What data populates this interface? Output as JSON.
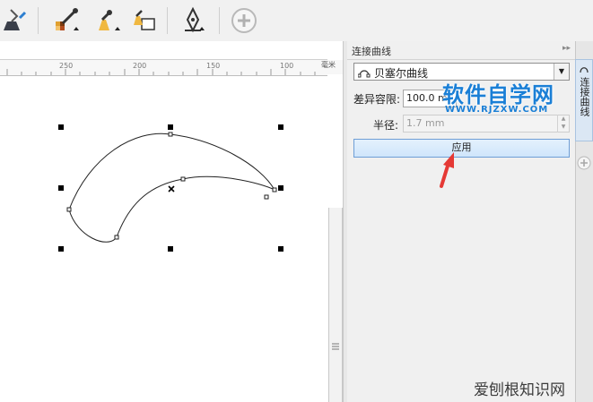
{
  "toolbar": {
    "tools": [
      {
        "icon": "fill-bucket-icon"
      },
      {
        "icon": "eyedropper-icon"
      },
      {
        "icon": "attribute-eyedropper-icon"
      },
      {
        "icon": "paint-bucket-icon"
      },
      {
        "icon": "copy-properties-icon"
      },
      {
        "icon": "pen-nib-icon"
      },
      {
        "icon": "add-icon"
      }
    ]
  },
  "ruler": {
    "ticks": [
      "250",
      "200",
      "150",
      "100"
    ],
    "unit": "毫米"
  },
  "docker": {
    "title": "连接曲线",
    "mode_select": {
      "value": "贝塞尔曲线",
      "icon": "bezier-curve-icon"
    },
    "tolerance": {
      "label": "差异容限:",
      "value": "100.0 m"
    },
    "radius": {
      "label": "半径:",
      "value": "1.7 mm"
    },
    "apply_label": "应用"
  },
  "side_tabs": {
    "connect_curves": "连接曲线"
  },
  "watermark": {
    "title": "软件自学网",
    "url": "WWW.RJZXW.COM",
    "bottom": "爱刨根知识网"
  },
  "colors": {
    "selection_handle": "#000000",
    "apply_button_border": "#6e9ed6",
    "watermark": "#1a7fd6",
    "arrow": "#e53935"
  }
}
